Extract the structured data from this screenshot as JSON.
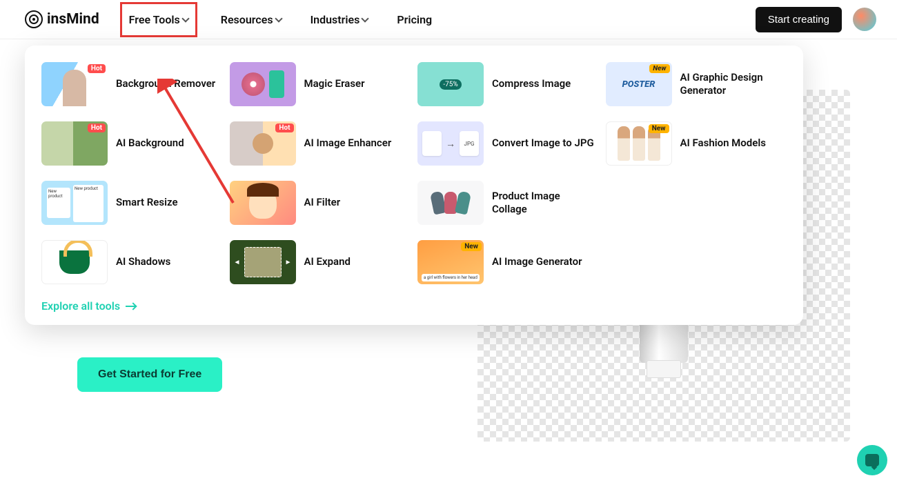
{
  "brand": "insMind",
  "nav": {
    "free_tools": "Free Tools",
    "resources": "Resources",
    "industries": "Industries",
    "pricing": "Pricing"
  },
  "header": {
    "start_creating": "Start creating"
  },
  "badges": {
    "hot": "Hot",
    "new": "New"
  },
  "tools": {
    "bg_remover": "Background Remover",
    "ai_background": "AI Background",
    "smart_resize": "Smart Resize",
    "ai_shadows": "AI Shadows",
    "magic_eraser": "Magic Eraser",
    "ai_enhancer": "AI Image Enhancer",
    "ai_filter": "AI Filter",
    "ai_expand": "AI Expand",
    "compress_image": "Compress Image",
    "convert_jpg": "Convert Image to JPG",
    "product_collage": "Product Image Collage",
    "ai_image_gen": "AI Image Generator",
    "ai_graphic_design": "AI Graphic Design Generator",
    "ai_fashion": "AI Fashion Models"
  },
  "convert": {
    "jpg_label": "JPG"
  },
  "poster_word": "POSTER",
  "explore_all": "Explore all tools",
  "cta": "Get Started for Free"
}
